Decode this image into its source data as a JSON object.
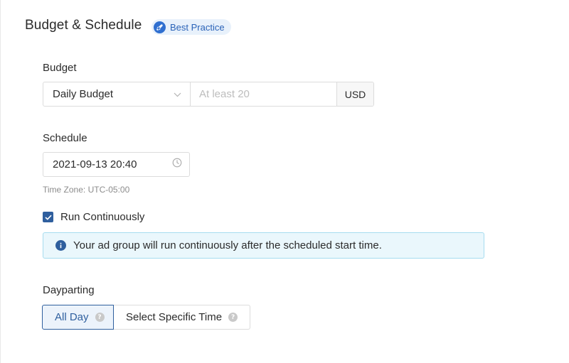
{
  "header": {
    "title": "Budget & Schedule",
    "badge_label": "Best Practice",
    "badge_icon": "rocket-icon"
  },
  "budget": {
    "label": "Budget",
    "type_selected": "Daily Budget",
    "amount_value": "",
    "amount_placeholder": "At least 20",
    "currency": "USD"
  },
  "schedule": {
    "label": "Schedule",
    "start_datetime": "2021-09-13 20:40",
    "timezone_text": "Time Zone: UTC-05:00",
    "run_continuously_label": "Run Continuously",
    "run_continuously_checked": true,
    "info_message": "Your ad group will run continuously after the scheduled start time."
  },
  "dayparting": {
    "label": "Dayparting",
    "options": [
      {
        "label": "All Day",
        "selected": true
      },
      {
        "label": "Select Specific Time",
        "selected": false
      }
    ]
  },
  "colors": {
    "accent": "#2f5f9e",
    "info_bg": "#eaf7fc",
    "info_border": "#a6dcef",
    "badge_bg": "#e8f1fb"
  }
}
